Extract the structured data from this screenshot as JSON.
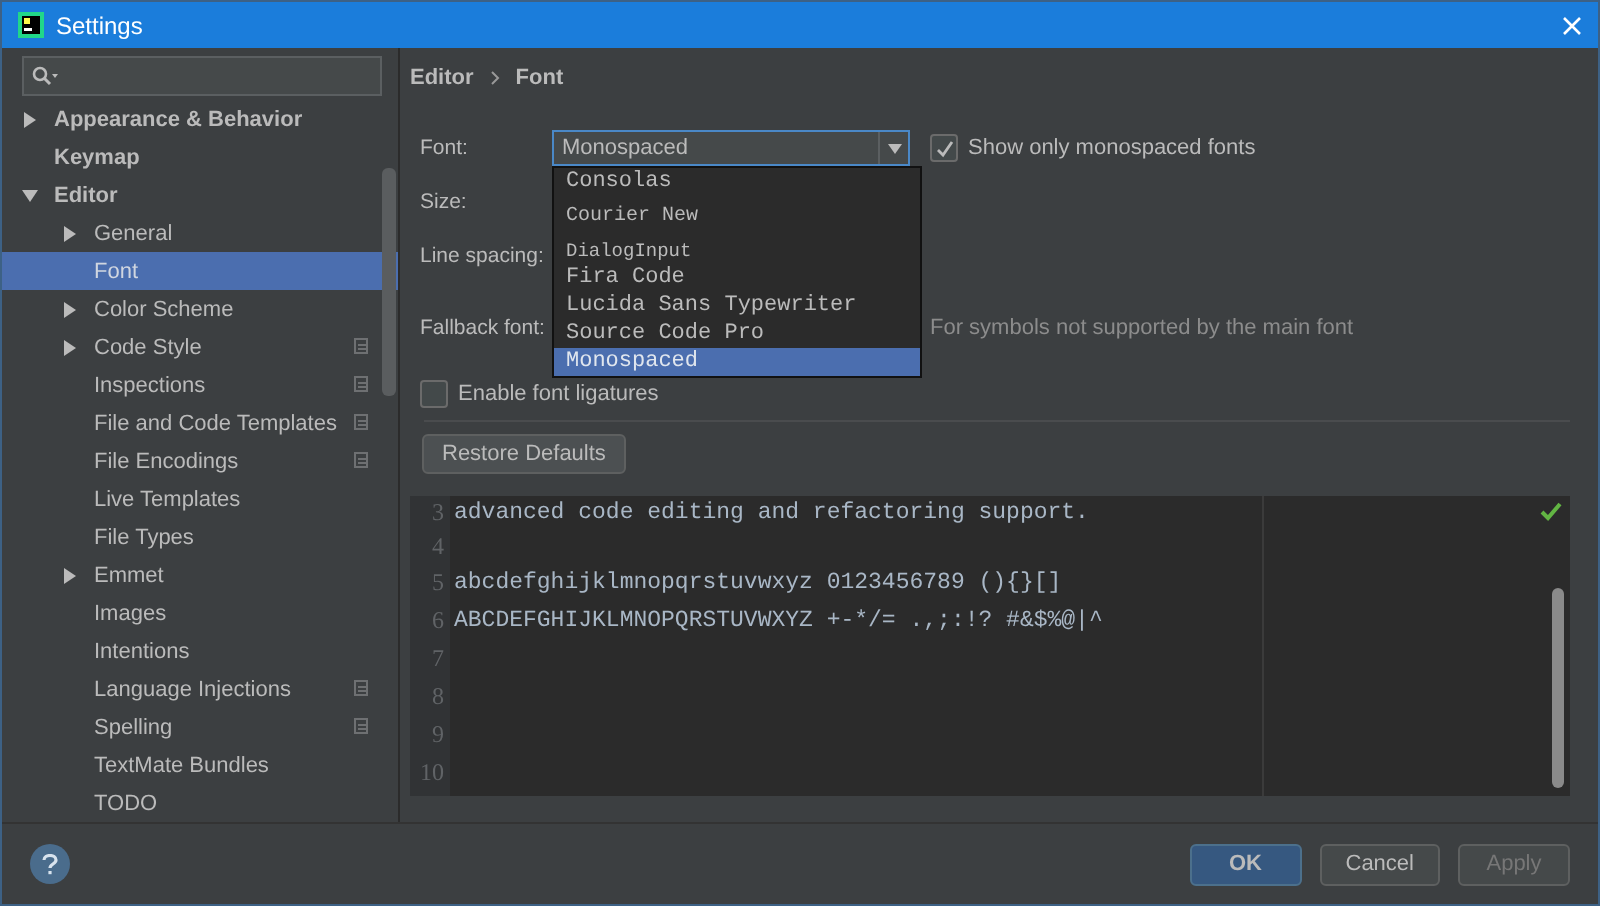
{
  "window": {
    "title": "Settings"
  },
  "sidebar": {
    "items": [
      {
        "label": "Appearance & Behavior",
        "expanded": false
      },
      {
        "label": "Keymap"
      },
      {
        "label": "Editor",
        "expanded": true,
        "children": [
          {
            "label": "General",
            "expanded": false,
            "selected": false,
            "scoped": false
          },
          {
            "label": "Font",
            "selected": true,
            "scoped": false
          },
          {
            "label": "Color Scheme",
            "expanded": false,
            "selected": false,
            "scoped": false
          },
          {
            "label": "Code Style",
            "expanded": false,
            "selected": false,
            "scoped": true
          },
          {
            "label": "Inspections",
            "selected": false,
            "scoped": true
          },
          {
            "label": "File and Code Templates",
            "selected": false,
            "scoped": true
          },
          {
            "label": "File Encodings",
            "selected": false,
            "scoped": true
          },
          {
            "label": "Live Templates",
            "selected": false,
            "scoped": false
          },
          {
            "label": "File Types",
            "selected": false,
            "scoped": false
          },
          {
            "label": "Emmet",
            "expanded": false,
            "selected": false,
            "scoped": false
          },
          {
            "label": "Images",
            "selected": false,
            "scoped": false
          },
          {
            "label": "Intentions",
            "selected": false,
            "scoped": false
          },
          {
            "label": "Language Injections",
            "selected": false,
            "scoped": true
          },
          {
            "label": "Spelling",
            "selected": false,
            "scoped": true
          },
          {
            "label": "TextMate Bundles",
            "selected": false,
            "scoped": false
          },
          {
            "label": "TODO",
            "selected": false,
            "scoped": false
          }
        ]
      }
    ]
  },
  "breadcrumb": [
    "Editor",
    "Font"
  ],
  "font_row": {
    "label": "Font:",
    "value": "Monospaced",
    "show_only_monospaced": {
      "label": "Show only monospaced fonts",
      "checked": true
    }
  },
  "font_dropdown": {
    "options": [
      {
        "label": "Consolas",
        "selected": false
      },
      {
        "label": "Courier New",
        "selected": false
      },
      {
        "label": "DialogInput",
        "selected": false
      },
      {
        "label": "Fira Code",
        "selected": false
      },
      {
        "label": "Lucida Sans Typewriter",
        "selected": false
      },
      {
        "label": "Source Code Pro",
        "selected": false
      },
      {
        "label": "Monospaced",
        "selected": true
      }
    ]
  },
  "size_label": "Size:",
  "line_spacing_label": "Line spacing:",
  "fallback": {
    "label": "Fallback font:",
    "hint": "For symbols not supported by the main font"
  },
  "ligatures": {
    "label": "Enable font ligatures",
    "checked": false
  },
  "restore_button": "Restore Defaults",
  "preview": {
    "lines": [
      {
        "number": "3",
        "text": "advanced code editing and refactoring support."
      },
      {
        "number": "4"
      },
      {
        "number": "5",
        "text": "abcdefghijklmnopqrstuvwxyz 0123456789 (){}[]"
      },
      {
        "number": "6",
        "text": "ABCDEFGHIJKLMNOPQRSTUVWXYZ +-*/= .,;:!? #&$%@|^"
      },
      {
        "number": "7"
      },
      {
        "number": "8"
      },
      {
        "number": "9"
      },
      {
        "number": "10"
      }
    ]
  },
  "buttons": [
    {
      "label": "OK",
      "kind": "primary"
    },
    {
      "label": "Cancel",
      "kind": "normal"
    },
    {
      "label": "Apply",
      "kind": "disabled"
    }
  ]
}
